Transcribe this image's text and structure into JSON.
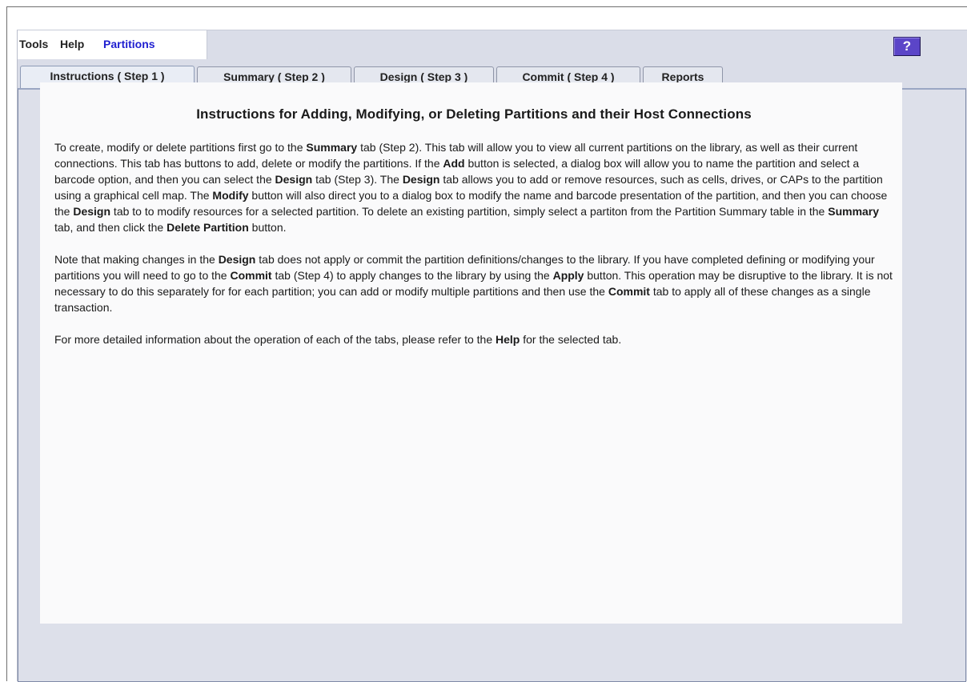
{
  "menubar": {
    "items": [
      {
        "label": "Tools"
      },
      {
        "label": "Help"
      },
      {
        "label": "Partitions"
      }
    ],
    "help_button_label": "?"
  },
  "tabs": [
    {
      "label": "Instructions ( Step 1 )",
      "active": true
    },
    {
      "label": "Summary ( Step 2 )",
      "active": false
    },
    {
      "label": "Design ( Step 3 )",
      "active": false
    },
    {
      "label": "Commit ( Step 4 )",
      "active": false
    },
    {
      "label": "Reports",
      "active": false
    }
  ],
  "content": {
    "heading": "Instructions for Adding, Modifying, or Deleting Partitions and their Host Connections",
    "paragraphs": [
      [
        {
          "text": "To create, modify or delete partitions first go to the "
        },
        {
          "text": "Summary",
          "bold": true
        },
        {
          "text": " tab (Step 2). This tab will allow you to view all current partitions on the library, as well as their current connections. This tab has buttons to add, delete or modify the partitions. If the "
        },
        {
          "text": "Add",
          "bold": true
        },
        {
          "text": " button is selected, a dialog box will allow you to name the partition and select a barcode option, and then you can select the "
        },
        {
          "text": "Design",
          "bold": true
        },
        {
          "text": " tab (Step 3). The "
        },
        {
          "text": "Design",
          "bold": true
        },
        {
          "text": " tab allows you to add or remove resources, such as cells, drives, or CAPs to the partition using a graphical cell map. The "
        },
        {
          "text": "Modify",
          "bold": true
        },
        {
          "text": " button will also direct you to a dialog box to modify the name and barcode presentation of the partition, and then you can choose the "
        },
        {
          "text": "Design",
          "bold": true
        },
        {
          "text": " tab to to modify resources for a selected partition. To delete an existing partition, simply select a partiton from the Partition Summary table in the "
        },
        {
          "text": "Summary",
          "bold": true
        },
        {
          "text": " tab, and then click the "
        },
        {
          "text": "Delete Partition",
          "bold": true
        },
        {
          "text": " button."
        }
      ],
      [
        {
          "text": "Note that making changes in the "
        },
        {
          "text": "Design",
          "bold": true
        },
        {
          "text": " tab does not apply or commit the partition definitions/changes to the library. If you have completed defining or modifying your partitions you will need to go to the "
        },
        {
          "text": "Commit",
          "bold": true
        },
        {
          "text": " tab (Step 4) to apply changes to the library by using the "
        },
        {
          "text": "Apply",
          "bold": true
        },
        {
          "text": " button. This operation may be disruptive to the library. It is not necessary to do this separately for for each partition; you can add or modify multiple partitions and then use the "
        },
        {
          "text": "Commit",
          "bold": true
        },
        {
          "text": " tab to apply all of these changes as a single transaction."
        }
      ],
      [
        {
          "text": "For more detailed information about the operation of each of the tabs, please refer to the "
        },
        {
          "text": "Help",
          "bold": true
        },
        {
          "text": " for the selected tab."
        }
      ]
    ]
  }
}
